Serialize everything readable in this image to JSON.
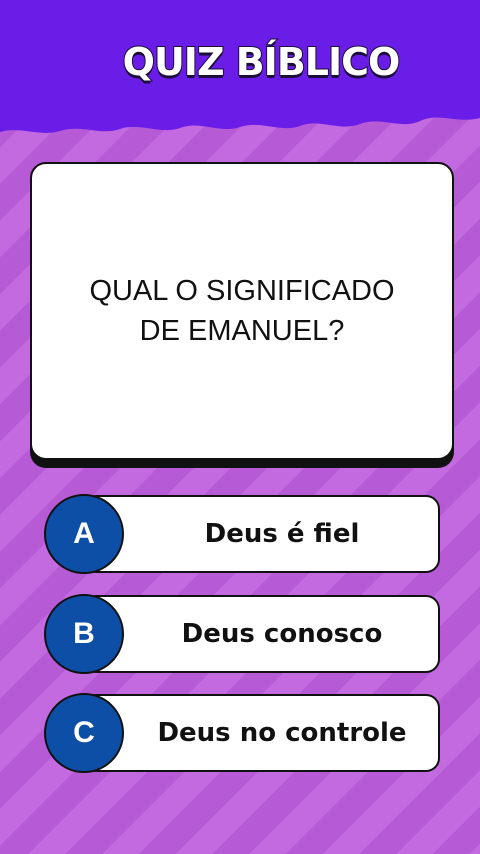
{
  "header": {
    "title": "QUIZ BÍBLICO"
  },
  "question": {
    "text": "QUAL O SIGNIFICADO\nDE EMANUEL?"
  },
  "answers": [
    {
      "letter": "A",
      "text": "Deus é fiel"
    },
    {
      "letter": "B",
      "text": "Deus conosco"
    },
    {
      "letter": "C",
      "text": "Deus no controle"
    }
  ],
  "colors": {
    "header_bg": "#6a1de6",
    "background_stripes": [
      "#c36ae0",
      "#b65ad6"
    ],
    "answer_circle": "#0d4ea6"
  }
}
